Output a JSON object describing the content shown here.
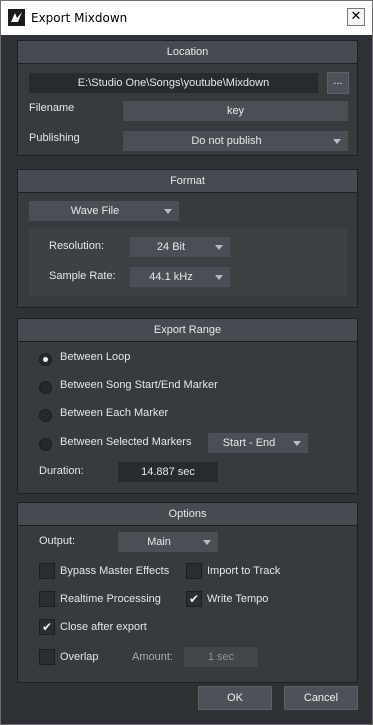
{
  "window": {
    "title": "Export Mixdown",
    "close_glyph": "✕",
    "logo_icon": "studio-one-logo-icon"
  },
  "location": {
    "header": "Location",
    "path": "E:\\Studio One\\Songs\\youtube\\Mixdown",
    "browse_label": "...",
    "filename_label": "Filename",
    "filename_value": "key",
    "publishing_label": "Publishing",
    "publishing_value": "Do not publish"
  },
  "format": {
    "header": "Format",
    "file_type": "Wave File",
    "resolution_label": "Resolution:",
    "resolution_value": "24 Bit",
    "sample_rate_label": "Sample Rate:",
    "sample_rate_value": "44.1 kHz"
  },
  "export_range": {
    "header": "Export Range",
    "options": [
      {
        "label": "Between Loop",
        "selected": true
      },
      {
        "label": "Between Song Start/End Marker",
        "selected": false
      },
      {
        "label": "Between Each Marker",
        "selected": false
      },
      {
        "label": "Between Selected Markers",
        "selected": false
      }
    ],
    "markers_value": "Start - End",
    "duration_label": "Duration:",
    "duration_value": "14.887 sec"
  },
  "options": {
    "header": "Options",
    "output_label": "Output:",
    "output_value": "Main",
    "bypass_master": {
      "label": "Bypass Master Effects",
      "checked": false
    },
    "import_to_track": {
      "label": "Import to Track",
      "checked": false
    },
    "realtime": {
      "label": "Realtime Processing",
      "checked": false
    },
    "write_tempo": {
      "label": "Write Tempo",
      "checked": true
    },
    "close_after": {
      "label": "Close after export",
      "checked": true
    },
    "overlap": {
      "label": "Overlap",
      "checked": false
    },
    "amount_label": "Amount:",
    "amount_value": "1 sec"
  },
  "buttons": {
    "ok": "OK",
    "cancel": "Cancel"
  },
  "colors": {
    "background": "#2e3236",
    "section": "#373b40",
    "header": "#464b51",
    "field": "#4a4f55"
  }
}
